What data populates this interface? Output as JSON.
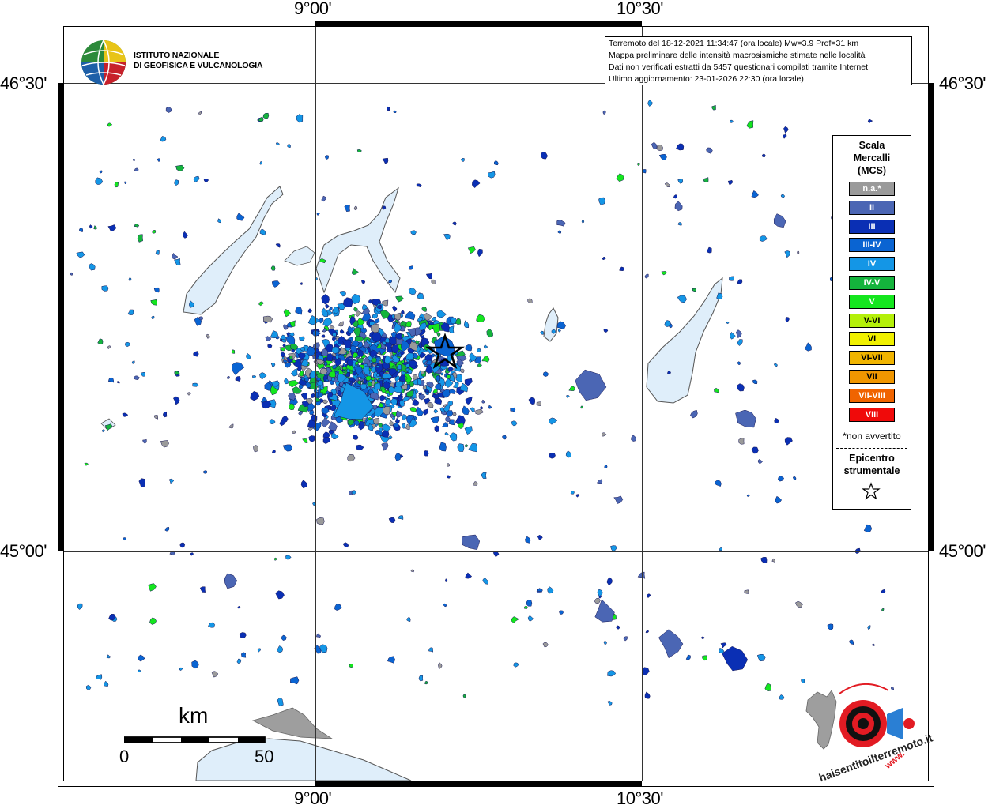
{
  "map": {
    "coordinate_labels": {
      "top": [
        "9°00'",
        "10°30'"
      ],
      "bottom": [
        "9°00'",
        "10°30'"
      ],
      "left": [
        "46°30'",
        "45°00'"
      ],
      "right": [
        "46°30'",
        "45°00'"
      ]
    },
    "epicenter_symbol": "star-icon"
  },
  "institute": {
    "line1": "ISTITUTO NAZIONALE",
    "line2": "DI GEOFISICA E VULCANOLOGIA",
    "logo": "ingv-globe-logo"
  },
  "info_box": {
    "line1": "Terremoto del 18-12-2021 11:34:47 (ora locale) Mw=3.9 Prof=31 km",
    "line2": "Mappa preliminare delle intensità macrosismiche stimate nelle località",
    "line3": "Dati non verificati estratti da 5457 questionari compilati tramite Internet.",
    "line4": "Ultimo aggiornamento: 23-01-2026 22:30 (ora locale)"
  },
  "legend": {
    "title_line1": "Scala",
    "title_line2": "Mercalli",
    "title_line3": "(MCS)",
    "items": [
      {
        "label": "n.a.*",
        "color": "#9a9a9a"
      },
      {
        "label": "II",
        "color": "#4b66b4"
      },
      {
        "label": "III",
        "color": "#0a2fb4"
      },
      {
        "label": "III-IV",
        "color": "#0a64d2"
      },
      {
        "label": "IV",
        "color": "#1496e6"
      },
      {
        "label": "IV-V",
        "color": "#14b43c"
      },
      {
        "label": "V",
        "color": "#14e61e"
      },
      {
        "label": "V-VI",
        "color": "#b4f00a"
      },
      {
        "label": "VI",
        "color": "#f0f000"
      },
      {
        "label": "VI-VII",
        "color": "#f0b400"
      },
      {
        "label": "VII",
        "color": "#f09600"
      },
      {
        "label": "VII-VIII",
        "color": "#f06400"
      },
      {
        "label": "VIII",
        "color": "#f00a0a"
      }
    ],
    "note": "*non avvertito",
    "epicenter_line1": "Epicentro",
    "epicenter_line2": "strumentale",
    "epicenter_icon": "star-icon"
  },
  "scale_bar": {
    "unit": "km",
    "start": "0",
    "end": "50"
  },
  "hsit_logo": {
    "text": "haisentitoilterremoto.it",
    "url_text": "www."
  }
}
